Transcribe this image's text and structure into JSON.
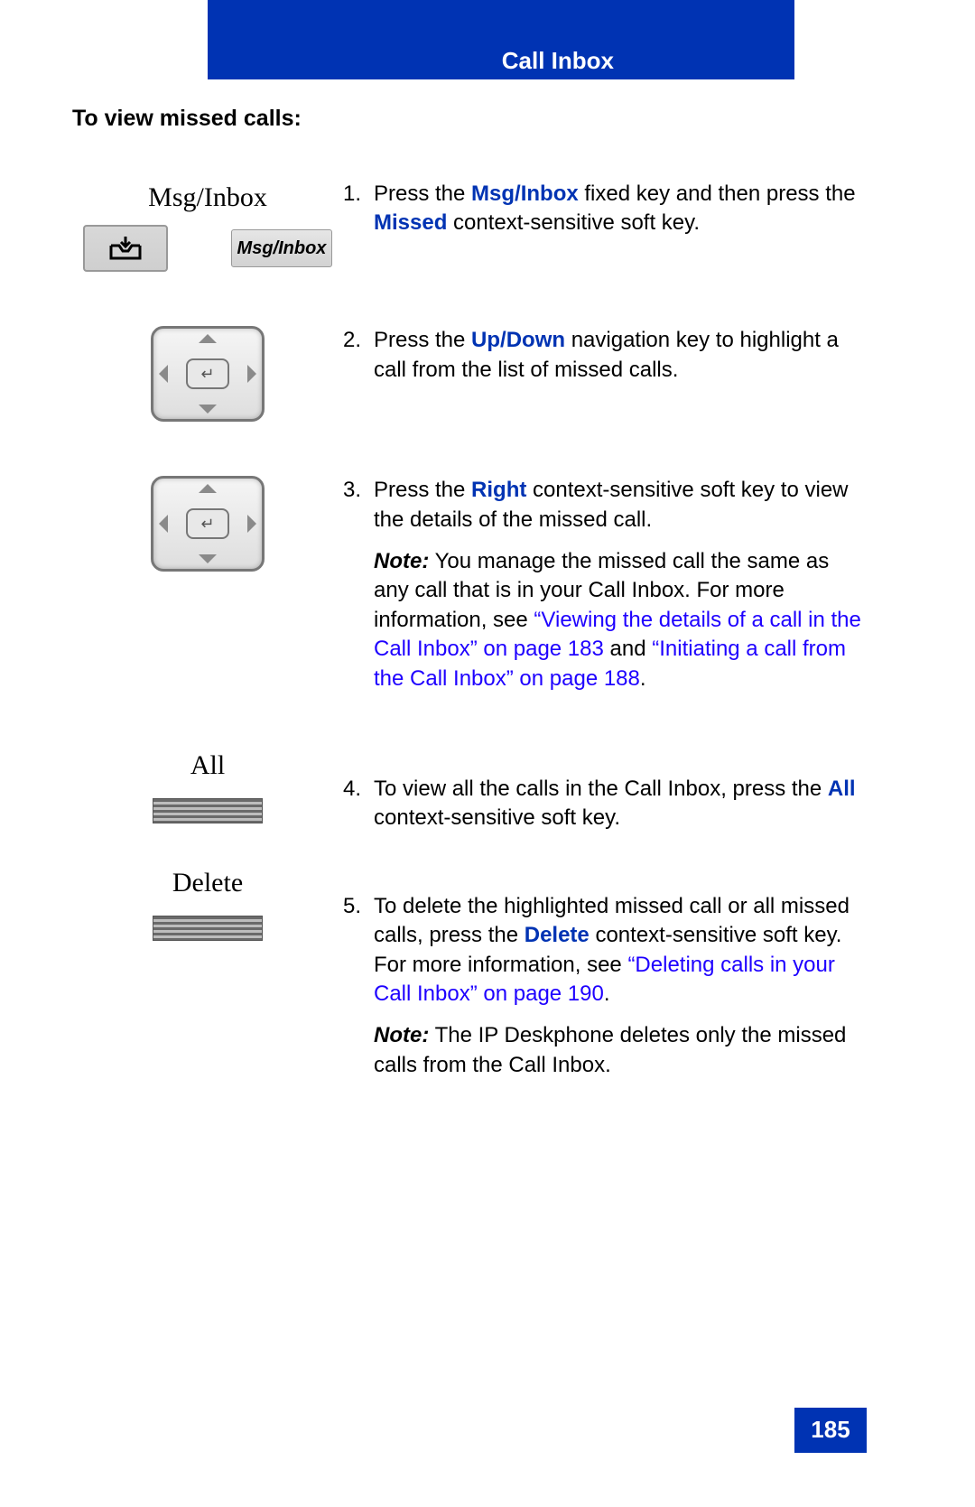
{
  "header": {
    "chapter_title": "Call Inbox"
  },
  "subheading": "To view missed calls:",
  "left": {
    "msg_label": "Msg/Inbox",
    "softkey_msginbox": "Msg/Inbox",
    "all_label": "All",
    "delete_label": "Delete",
    "enter_glyph": "↵"
  },
  "steps": {
    "s1": {
      "num": "1.",
      "t1": "Press the ",
      "k1": "Msg/Inbox",
      "t2": " fixed key and then press the ",
      "k2": "Missed",
      "t3": " context-sensitive soft key."
    },
    "s2": {
      "num": "2.",
      "t1": "Press the ",
      "k1": "Up/Down",
      "t2": " navigation key to highlight a call from the list of missed calls."
    },
    "s3": {
      "num": "3.",
      "t1": "Press the ",
      "k1": "Right",
      "t2": " context-sensitive soft key to view the details of the missed call.",
      "note_label": "Note:",
      "note1": "  You manage the missed call the same as any call that is in your Call Inbox. For more information, see ",
      "link1": "“Viewing the details of a call in the Call Inbox” on page 183",
      "mid": " and ",
      "link2": "“Initiating a call from the Call Inbox” on page 188",
      "end": "."
    },
    "s4": {
      "num": "4.",
      "t1": "To view all the calls in the Call Inbox, press the ",
      "k1": "All",
      "t2": " context-sensitive soft key."
    },
    "s5": {
      "num": "5.",
      "t1": "To delete the highlighted missed call or all missed calls, press the ",
      "k1": "Delete",
      "t2": " context-sensitive soft key. For more information, see ",
      "link1": "“Deleting calls in your Call Inbox” on page 190",
      "end": ".",
      "note_label": "Note:",
      "note2": "  The IP Deskphone deletes only the missed calls from the Call Inbox."
    }
  },
  "page_number": "185"
}
